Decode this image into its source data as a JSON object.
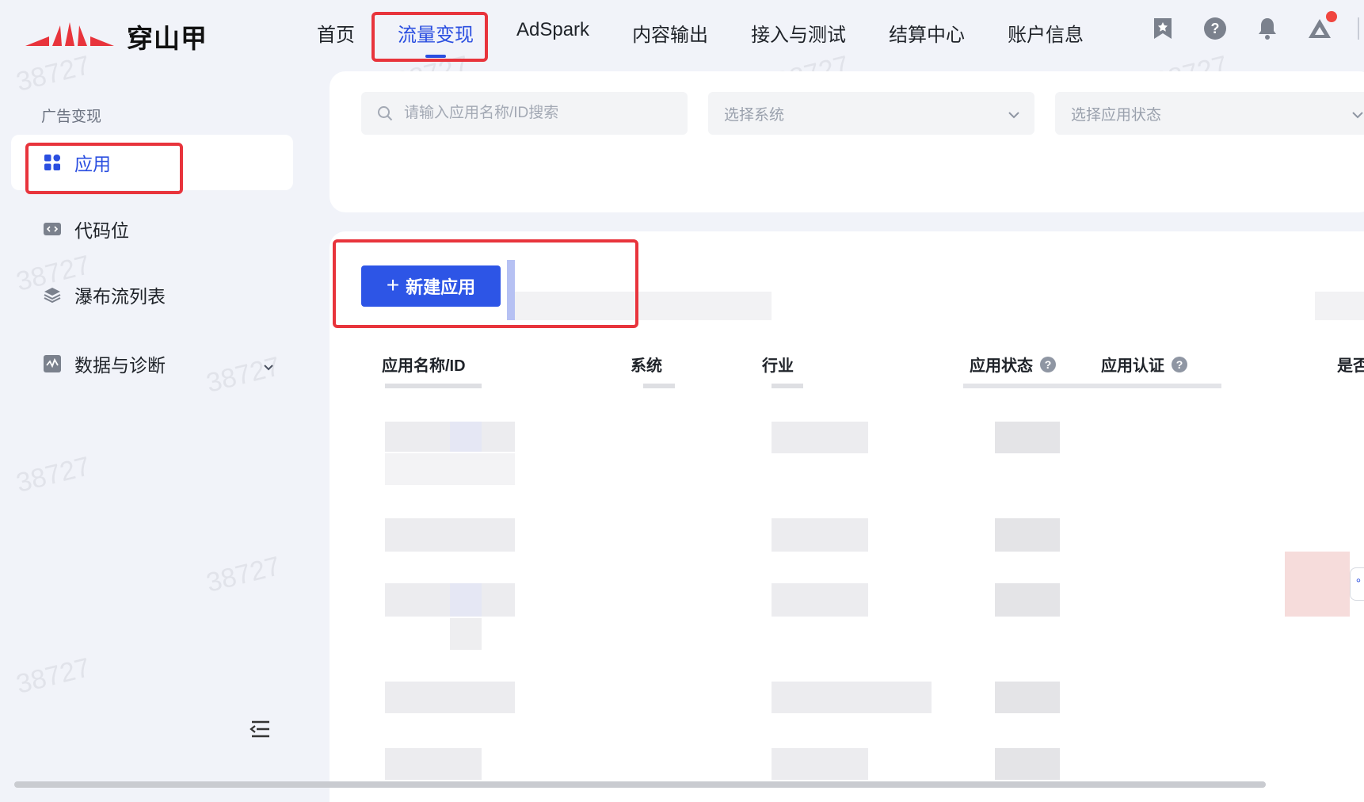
{
  "header": {
    "logo_text": "穿山甲",
    "nav": [
      {
        "label": "首页"
      },
      {
        "label": "流量变现"
      },
      {
        "label": "AdSpark"
      },
      {
        "label": "内容输出"
      },
      {
        "label": "接入与测试"
      },
      {
        "label": "结算中心"
      },
      {
        "label": "账户信息"
      }
    ],
    "icons": [
      "bookmark-icon",
      "help-icon",
      "bell-icon",
      "user-avatar-icon"
    ]
  },
  "sidebar": {
    "group_label": "广告变现",
    "items": [
      {
        "label": "应用",
        "icon": "grid-icon",
        "active": true
      },
      {
        "label": "代码位",
        "icon": "code-icon"
      },
      {
        "label": "瀑布流列表",
        "icon": "layers-icon"
      },
      {
        "label": "数据与诊断",
        "icon": "chart-icon",
        "expandable": true
      }
    ]
  },
  "filters": {
    "search_placeholder": "请输入应用名称/ID搜索",
    "system_placeholder": "选择系统",
    "status_placeholder": "选择应用状态"
  },
  "toolbar": {
    "new_app_label": "新建应用"
  },
  "table": {
    "columns": [
      "应用名称/ID",
      "系统",
      "行业",
      "应用状态",
      "应用认证",
      "是否"
    ],
    "help_mark": "?"
  },
  "watermark": "38727",
  "colors": {
    "accent": "#2a4ee0",
    "button": "#2d55e6",
    "highlight": "#e8343c",
    "logo_red": "#e8343c"
  }
}
